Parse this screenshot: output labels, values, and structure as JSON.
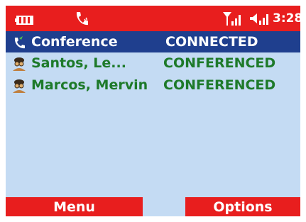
{
  "status_bar": {
    "battery_icon": "battery-icon",
    "call_icon": "phone-call-icon",
    "signal_icon": "signal-strength-icon",
    "volume_icon": "volume-icon",
    "time": "3:28"
  },
  "calls": [
    {
      "name": "Conference",
      "status": "CONNECTED",
      "icon": "conference-phone-icon",
      "selected": true
    },
    {
      "name": "Santos, Le...",
      "status": "CONFERENCED",
      "icon": "person-icon",
      "selected": false
    },
    {
      "name": "Marcos, Mervin",
      "status": "CONFERENCED",
      "icon": "person-icon",
      "selected": false
    }
  ],
  "softkeys": {
    "left": "Menu",
    "right": "Options"
  },
  "colors": {
    "status_bar": "#e81e1e",
    "background": "#c4dbf3",
    "selection": "#1f3f8e",
    "conferenced_text": "#1e7a2a"
  }
}
